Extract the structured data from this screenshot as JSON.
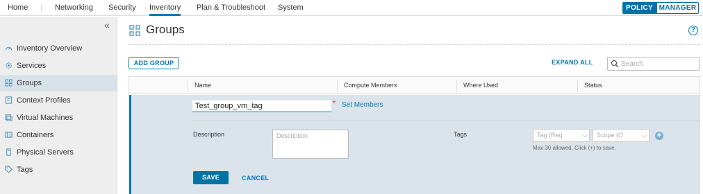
{
  "topnav": {
    "tabs": [
      {
        "label": "Home"
      },
      {
        "label": "Networking"
      },
      {
        "label": "Security"
      },
      {
        "label": "Inventory"
      },
      {
        "label": "Plan & Troubleshoot"
      },
      {
        "label": "System"
      }
    ],
    "active_tab": "Inventory",
    "mode_policy": "POLICY",
    "mode_manager": "MANAGER"
  },
  "sidebar": {
    "collapse_glyph": "«",
    "items": [
      {
        "label": "Inventory Overview",
        "icon": "dashboard-icon"
      },
      {
        "label": "Services",
        "icon": "gear-icon"
      },
      {
        "label": "Groups",
        "icon": "groups-icon"
      },
      {
        "label": "Context Profiles",
        "icon": "context-profile-icon"
      },
      {
        "label": "Virtual Machines",
        "icon": "vm-icon"
      },
      {
        "label": "Containers",
        "icon": "container-icon"
      },
      {
        "label": "Physical Servers",
        "icon": "server-icon"
      },
      {
        "label": "Tags",
        "icon": "tag-icon"
      }
    ],
    "active_item": "Groups"
  },
  "header": {
    "title": "Groups",
    "help": "?"
  },
  "toolbar": {
    "add_group": "ADD GROUP",
    "expand_all": "EXPAND ALL",
    "search_placeholder": "Search"
  },
  "grid": {
    "columns": [
      "Name",
      "Compute Members",
      "Where Used",
      "Status"
    ]
  },
  "edit_row": {
    "name_value": "Test_group_vm_tag",
    "required_mark": "*",
    "set_members": "Set Members",
    "description_label": "Description",
    "description_placeholder": "Description",
    "tags_label": "Tags",
    "tag_placeholder": "Tag (Req",
    "scope_placeholder": "Scope (O",
    "tags_hint": "Max 30 allowed. Click (+) to save.",
    "save": "SAVE",
    "cancel": "CANCEL"
  },
  "colors": {
    "accent": "#0079b8",
    "primary_button": "#0072a3",
    "edit_row_bg": "#dbe4ea",
    "sidebar_bg": "#eeeeee",
    "sidebar_active": "#d8e3e9"
  }
}
